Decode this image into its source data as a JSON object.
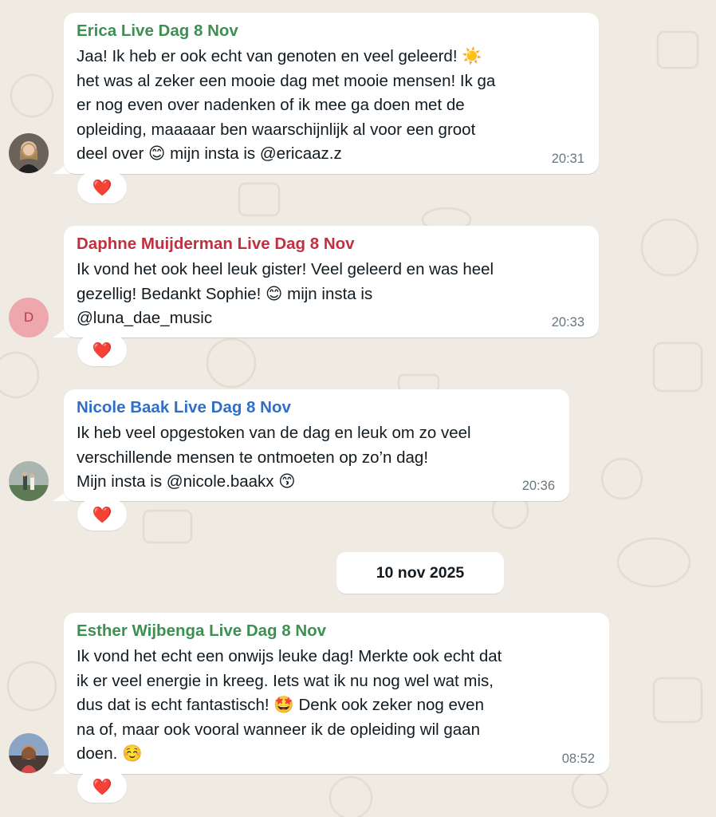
{
  "messages": [
    {
      "sender": "Erica Live Dag 8 Nov",
      "sender_color": "#3f8f53",
      "text": "Jaa! Ik heb er ook echt van genoten en veel geleerd! ☀️\nhet was al zeker een mooie dag met mooie mensen! Ik ga\ner nog even over nadenken of ik mee ga doen met de\nopleiding, maaaaar ben waarschijnlijk al voor een groot\ndeel over 😊 mijn insta is @ericaaz.z",
      "time": "20:31",
      "reaction": "❤️",
      "avatar": "photo"
    },
    {
      "sender": "Daphne Muijderman Live Dag 8 Nov",
      "sender_color": "#c0303f",
      "text": "Ik vond het ook heel leuk gister! Veel geleerd en was heel\ngezellig! Bedankt Sophie! 😊 mijn insta is\n@luna_dae_music",
      "time": "20:33",
      "reaction": "❤️",
      "avatar": "D"
    },
    {
      "sender": "Nicole Baak Live Dag 8 Nov",
      "sender_color": "#2f6fc9",
      "text": "Ik heb veel opgestoken van de dag en leuk om zo veel\nverschillende mensen te ontmoeten op zo’n dag!\nMijn insta is @nicole.baakx 😙",
      "time": "20:36",
      "reaction": "❤️",
      "avatar": "photo"
    },
    {
      "sender": "Esther Wijbenga Live Dag 8 Nov",
      "sender_color": "#3f8f53",
      "text": "Ik vond het echt een onwijs leuke dag! Merkte ook echt dat\nik er veel energie in kreeg. Iets wat ik nu nog wel wat mis,\ndus dat is echt fantastisch! 🤩 Denk ook zeker nog even\nna of, maar ook vooral wanneer ik de opleiding wil gaan\ndoen. ☺️",
      "time": "08:52",
      "reaction": "❤️",
      "avatar": "photo"
    }
  ],
  "date_separator": "10 nov 2025"
}
